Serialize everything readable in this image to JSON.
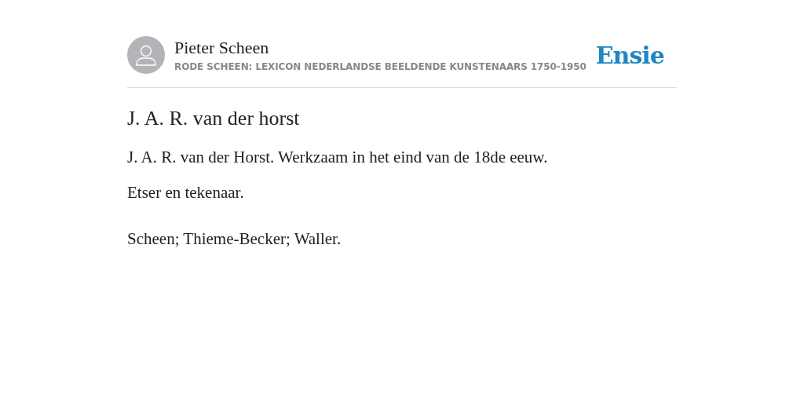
{
  "header": {
    "author": "Pieter Scheen",
    "source": "RODE SCHEEN: LEXICON NEDERLANDSE BEELDENDE KUNSTENAARS 1750-1950",
    "logo": "Ensie"
  },
  "article": {
    "title": "J. A. R. van der horst",
    "paragraphs": [
      "J. A. R. van der Horst. Werkzaam in het eind van de 18de eeuw.",
      "Etser en tekenaar."
    ],
    "sources": "Scheen; Thieme-Becker; Waller."
  }
}
